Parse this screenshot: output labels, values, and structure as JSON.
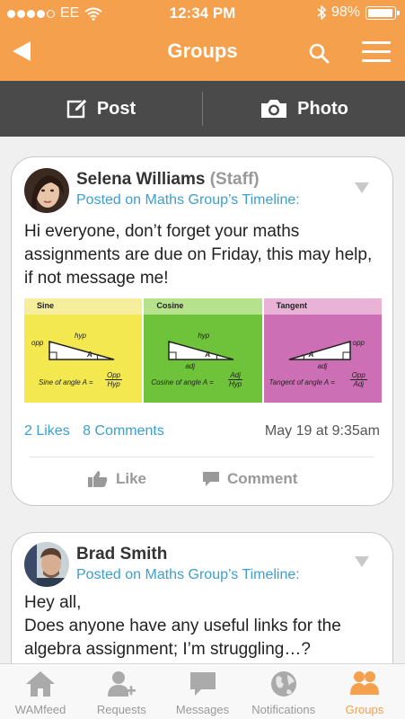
{
  "status_bar": {
    "carrier": "EE",
    "time": "12:34 PM",
    "battery": "98%",
    "battery_level": 0.98
  },
  "header": {
    "title": "Groups"
  },
  "action_bar": {
    "post_label": "Post",
    "photo_label": "Photo"
  },
  "posts": [
    {
      "author": "Selena Williams",
      "role": "(Staff)",
      "posted_on": "Posted on Maths Group’s Timeline:",
      "text": "Hi everyone, don’t forget your maths assignments are due on Friday, this may help, if not message me!",
      "attachment": {
        "columns": [
          {
            "title": "Sine",
            "opp": "opp",
            "hyp": "hyp",
            "angle": "A",
            "formula": "Sine of angle A =",
            "num": "Opp",
            "den": "Hyp"
          },
          {
            "title": "Cosine",
            "hyp": "hyp",
            "adj": "adj",
            "angle": "A",
            "formula": "Cosine of angle A =",
            "num": "Adj",
            "den": "Hyp"
          },
          {
            "title": "Tangent",
            "opp": "opp",
            "adj": "adj",
            "angle": "A",
            "formula": "Tangent of angle A =",
            "num": "Opp",
            "den": "Adj"
          }
        ]
      },
      "likes": "2 Likes",
      "comments": "8 Comments",
      "date": "May 19 at 9:35am",
      "like_label": "Like",
      "comment_label": "Comment"
    },
    {
      "author": "Brad Smith",
      "posted_on": "Posted on Maths Group’s Timeline:",
      "text_line1": "Hey all,",
      "text_line2": "Does anyone have any useful links for the algebra assignment; I’m struggling…?"
    }
  ],
  "tab_bar": {
    "tabs": [
      {
        "label": "WAMfeed",
        "icon": "home-icon"
      },
      {
        "label": "Requests",
        "icon": "add-user-icon"
      },
      {
        "label": "Messages",
        "icon": "speech-bubble-icon"
      },
      {
        "label": "Notifications",
        "icon": "globe-icon"
      },
      {
        "label": "Groups",
        "icon": "group-icon"
      }
    ],
    "active": "Groups"
  },
  "colors": {
    "accent": "#f5a04c",
    "link": "#3c9fd0",
    "action_bar": "#4a4a4a"
  }
}
